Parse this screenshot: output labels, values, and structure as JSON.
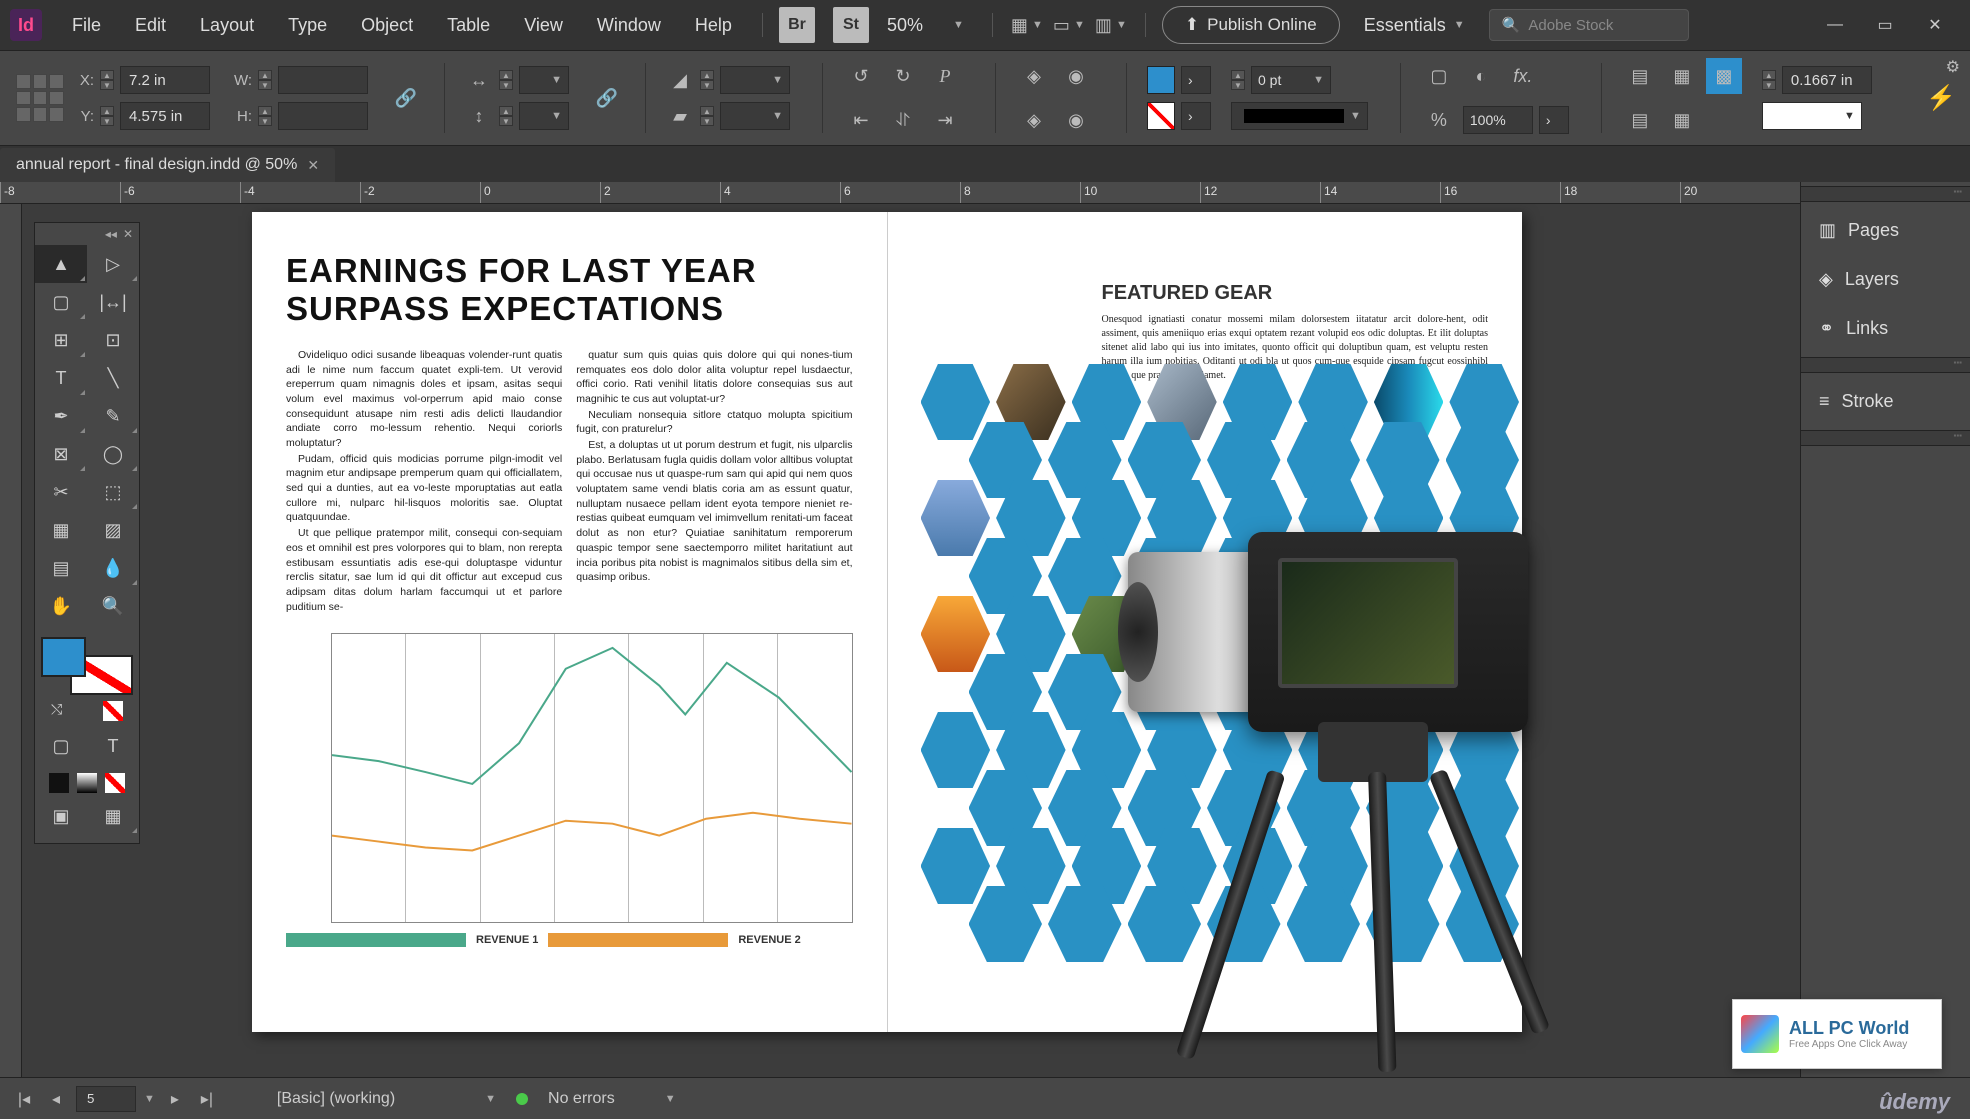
{
  "menu": {
    "items": [
      "File",
      "Edit",
      "Layout",
      "Type",
      "Object",
      "Table",
      "View",
      "Window",
      "Help"
    ],
    "br": "Br",
    "st": "St",
    "zoom": "50%",
    "publish": "Publish Online",
    "workspace": "Essentials",
    "stock_placeholder": "Adobe Stock"
  },
  "control": {
    "x_label": "X:",
    "x_val": "7.2 in",
    "y_label": "Y:",
    "y_val": "4.575 in",
    "w_label": "W:",
    "h_label": "H:",
    "stroke_pt": "0 pt",
    "scale_pct": "100%",
    "leading": "0.1667 in"
  },
  "tab": {
    "title": "annual report - final design.indd @ 50%"
  },
  "panels": [
    "Pages",
    "Layers",
    "Links",
    "Stroke"
  ],
  "doc": {
    "headline": "EARNINGS FOR LAST YEAR SURPASS EXPECTATIONS",
    "col1_p1": "Ovideliquo odici susande libeaquas volender-runt quatis adi le nime num faccum quatet expli-tem. Ut verovid ereperrum quam nimagnis doles et ipsam, asitas sequi volum evel maximus vol-orperrum apid maio conse consequidunt atusape nim resti adis delicti llaudandior andiate corro mo-lessum rehentio. Nequi coriorls moluptatur?",
    "col1_p2": "Pudam, officid quis modicias porrume pilgn-imodit vel magnim etur andipsape premperum quam qui officiallatem, sed qui a dunties, aut ea vo-leste mporuptatias aut eatla cullore mi, nulparc hil-lisquos moloritis sae. Oluptat quatquundae.",
    "col1_p3": "Ut que pellique pratempor milit, consequi con-sequiam eos et omnihil est pres volorpores qui to blam, non rerepta estibusam essuntiatis adis ese-qui doluptaspe viduntur rerclis sitatur, sae lum id qui dit offictur aut excepud cus adipsam ditas dolum harlam faccumqui ut et parlore puditium se-",
    "col2_p1": "quatur sum quis quias quis dolore qui qui nones-tium remquates eos dolo dolor alita voluptur repel lusdaectur, offici corio. Rati venihil litatis dolore consequias sus aut magnihic te cus aut voluptat-ur?",
    "col2_p2": "Neculiam nonsequia sitlore ctatquo molupta spicitium fugit, con praturelur?",
    "col2_p3": "Est, a doluptas ut ut porum destrum et fugit, nis ulparclis plabo. Berlatusam fugla quidis dollam volor alltibus voluptat qui occusae nus ut quaspe-rum sam qui apid qui nem quos voluptatem same vendi blatis coria am as essunt quatur, nulluptam nusaece pellam ident eyota tempore nieniet re-restias quibeat eumquam vel imimvellum renitati-um faceat dolut as non etur? Quiatiae sanihitatum remporerum quaspic tempor sene saectemporro militet haritatiunt aut incia poribus pita nobist is magnimalos sitibus della sim et, quasimp oribus.",
    "legend1": "REVENUE 1",
    "legend2": "REVENUE 2",
    "featured_title": "FEATURED GEAR",
    "featured_body": "Onesquod ignatiasti conatur mossemi milam dolorsestem iitatatur arcit dolore-hent, odit assiment, quis ameniiquo erias exqui optatem rezant volupid eos odic doluptas. Et ilit doluptas sitenet alid labo qui ius into imitates, quonto officit qui doluptibun quam, est veluptu resten harum illa ium nobitias. Oditanti ut odi bla ut quos cum-que esquide cipsam fugcut eossinhibl quodia que prat plia quo lamet."
  },
  "chart_data": {
    "type": "line",
    "x": [
      1,
      2,
      3,
      4,
      5,
      6,
      7,
      8,
      9,
      10,
      11,
      12
    ],
    "series": [
      {
        "name": "REVENUE 1",
        "color": "#4aa88a",
        "values": [
          58,
          56,
          52,
          48,
          62,
          88,
          95,
          82,
          72,
          90,
          78,
          52
        ]
      },
      {
        "name": "REVENUE 2",
        "color": "#e89a3a",
        "values": [
          30,
          28,
          26,
          25,
          30,
          35,
          34,
          30,
          36,
          38,
          36,
          34
        ]
      }
    ],
    "ylim": [
      0,
      100
    ],
    "xlabel": "",
    "ylabel": "",
    "legend_pos": "bottom"
  },
  "ruler_ticks": [
    "-8",
    "-6",
    "-4",
    "-2",
    "0",
    "2",
    "4",
    "6",
    "8",
    "10",
    "12",
    "14",
    "16",
    "18",
    "20"
  ],
  "status": {
    "page": "5",
    "preset": "[Basic] (working)",
    "errors": "No errors"
  },
  "watermark": {
    "allpc_title": "ALL PC World",
    "allpc_sub": "Free Apps One Click Away",
    "udemy": "ûdemy"
  }
}
